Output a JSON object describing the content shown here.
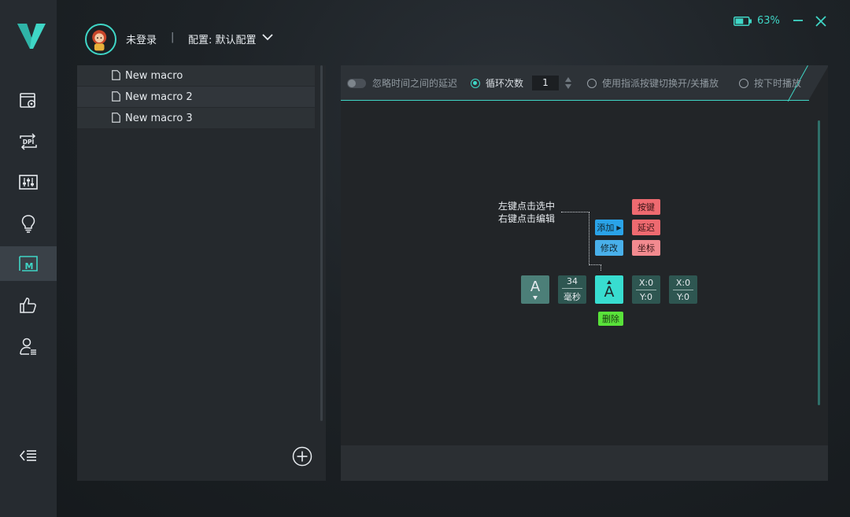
{
  "header": {
    "user": "未登录",
    "separator": "|",
    "config": "配置: 默认配置"
  },
  "window": {
    "battery_percent": "63%",
    "battery_level": 0.63
  },
  "sidebar": {
    "items": [
      {
        "name": "settings-icon"
      },
      {
        "name": "dpi-icon"
      },
      {
        "name": "equalizer-icon"
      },
      {
        "name": "lightbulb-icon"
      },
      {
        "name": "macro-icon",
        "active": true
      },
      {
        "name": "thumbs-up-icon"
      },
      {
        "name": "user-icon"
      }
    ],
    "collapse_icon": "menu-collapse-icon",
    "dpi_text": "DPI",
    "macro_text": "M"
  },
  "macros": {
    "items": [
      "New macro",
      "New macro 2",
      "New macro 3"
    ]
  },
  "toolbar": {
    "ignore_delay": "忽略时间之间的延迟",
    "loop_count": "循环次数",
    "loop_value": "1",
    "toggle_mode": "使用指派按键切换开/关播放",
    "hold_play": "按下时播放"
  },
  "editor": {
    "hint_line1": "左键点击选中",
    "hint_line2": "右键点击编辑",
    "add": "添加",
    "modify": "修改",
    "key": "按键",
    "delay": "延迟",
    "coord": "坐标",
    "delete": "删除",
    "actions": {
      "key1": "A",
      "delay_value": "34",
      "delay_unit": "毫秒",
      "key2": "A",
      "coord1_x": "X:0",
      "coord1_y": "Y:0",
      "coord2_x": "X:0",
      "coord2_y": "Y:0"
    }
  },
  "colors": {
    "accent": "#3fd6c6",
    "blue": "#2aa3e8",
    "red": "#ee6a70",
    "green": "#59e23a"
  }
}
